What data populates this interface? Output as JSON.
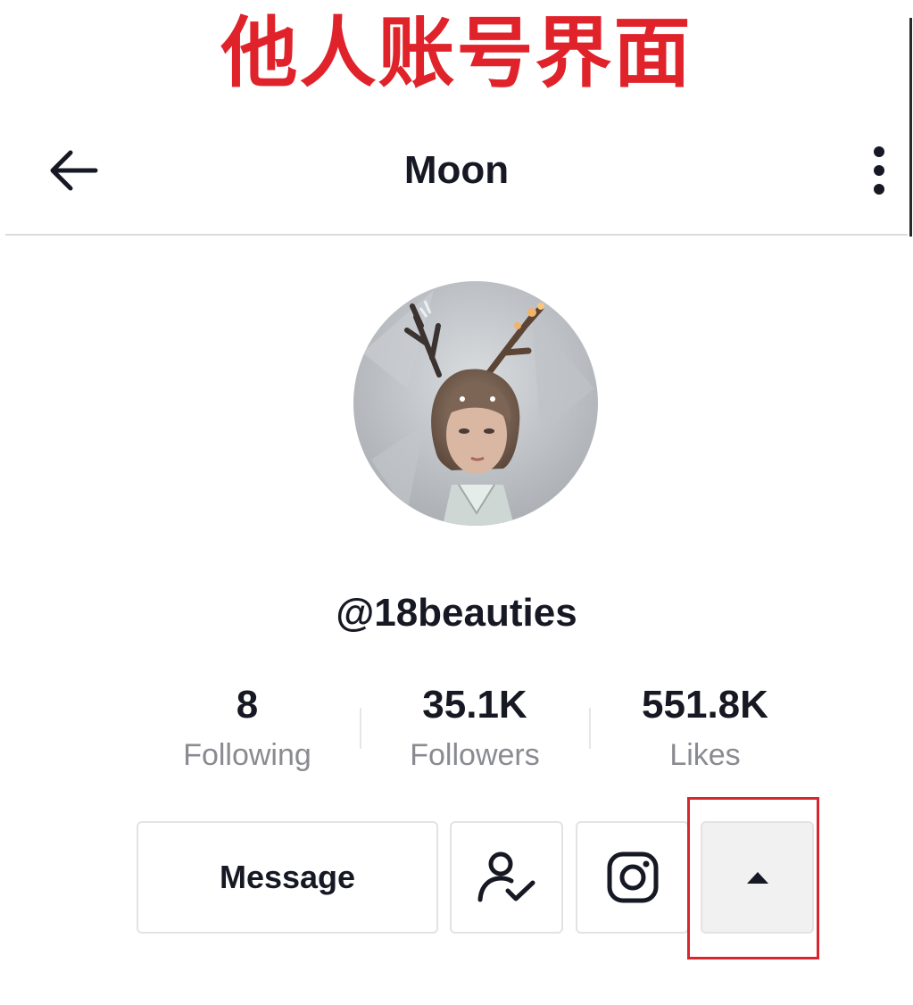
{
  "annotation": {
    "banner_text": "他人账号界面",
    "banner_color": "#e0222a",
    "highlight_color": "#d8262e"
  },
  "header": {
    "title": "Moon",
    "back_icon": "arrow-left-icon",
    "more_icon": "vertical-ellipsis-icon"
  },
  "profile": {
    "username": "@18beauties",
    "avatar": "profile-avatar"
  },
  "stats": [
    {
      "value": "8",
      "label": "Following"
    },
    {
      "value": "35.1K",
      "label": "Followers"
    },
    {
      "value": "551.8K",
      "label": "Likes"
    }
  ],
  "actions": {
    "message_label": "Message",
    "following_icon": "person-check-icon",
    "instagram_icon": "instagram-icon",
    "expand_icon": "caret-up-icon"
  }
}
